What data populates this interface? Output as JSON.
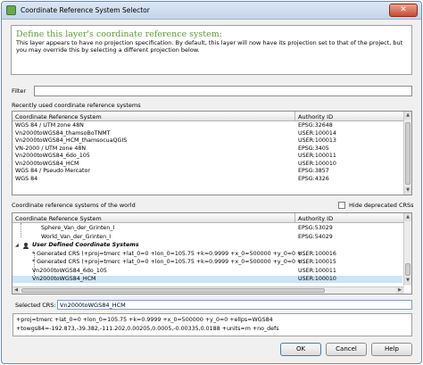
{
  "window": {
    "title": "Coordinate Reference System Selector",
    "close_label": "✕"
  },
  "message": {
    "heading": "Define this layer's coordinate reference system:",
    "body": "This layer appears to have no projection specification. By default, this layer will now have its projection set to that of the project, but you may override this by selecting a different projection below."
  },
  "filter": {
    "label": "Filter",
    "value": ""
  },
  "recent": {
    "label": "Recently used coordinate reference systems",
    "columns": [
      "Coordinate Reference System",
      "Authority ID"
    ],
    "rows": [
      {
        "crs": "WGS 84 / UTM zone 48N",
        "auth": "EPSG:32648"
      },
      {
        "crs": "Vn2000toWGS84_thamsoBoTNMT",
        "auth": "USER:100014"
      },
      {
        "crs": "Vn2000toWGS84_HCM_thamsocuaQGIS",
        "auth": "USER:100013"
      },
      {
        "crs": "VN-2000 / UTM zone 48N",
        "auth": "EPSG:3405"
      },
      {
        "crs": "Vn2000toWGS84_6do_105",
        "auth": "USER:100011"
      },
      {
        "crs": "Vn2000toWGS84_HCM",
        "auth": "USER:100010"
      },
      {
        "crs": "WGS 84 / Pseudo Mercator",
        "auth": "EPSG:3857"
      },
      {
        "crs": "WGS 84",
        "auth": "EPSG:4326"
      }
    ]
  },
  "world": {
    "label": "Coordinate reference systems of the world",
    "hide_deprecated_label": "Hide deprecated CRSs",
    "hide_deprecated_checked": false,
    "columns": [
      "Coordinate Reference System",
      "Authority ID"
    ],
    "rows": [
      {
        "crs": "Sphere_Van_der_Grinten_I",
        "auth": "EPSG:53029",
        "indent": 2,
        "bold": false
      },
      {
        "crs": "World_Van_der_Grinten_I",
        "auth": "EPSG:54029",
        "indent": 2,
        "bold": false
      },
      {
        "crs": "User Defined Coordinate Systems",
        "auth": "",
        "indent": 0,
        "bold": true
      },
      {
        "crs": "* Generated CRS (+proj=tmerc +lat_0=0 +lon_0=105.75 +k=0.9999 +x_0=500000 +y_0=0 +...",
        "auth": "USER:100016",
        "indent": 1,
        "bold": false
      },
      {
        "crs": "* Generated CRS (+proj=tmerc +lat_0=0 +lon_0=105.75 +k=0.9999 +x_0=500000 +y_0=0 +...",
        "auth": "USER:100015",
        "indent": 1,
        "bold": false
      },
      {
        "crs": "Vn2000toWGS84_6do_105",
        "auth": "USER:100011",
        "indent": 1,
        "bold": false
      },
      {
        "crs": "Vn2000toWGS84_HCM",
        "auth": "USER:100010",
        "indent": 1,
        "bold": false,
        "selected": true
      }
    ]
  },
  "selected": {
    "label": "Selected CRS:",
    "value": "Vn2000toWGS84_HCM",
    "proj_line1": "+proj=tmerc +lat_0=0 +lon_0=105.75 +k=0.9999 +x_0=500000 +y_0=0 +ellps=WGS84",
    "proj_line2": "+towgs84=-192.873,-39.382,-111.202,0.00205,0.0005,-0.00335,0.0188 +units=m +no_defs"
  },
  "buttons": {
    "ok": "OK",
    "cancel": "Cancel",
    "help": "Help"
  },
  "colors": {
    "heading_green": "#5f9b3a",
    "selection": "#3399ff"
  }
}
